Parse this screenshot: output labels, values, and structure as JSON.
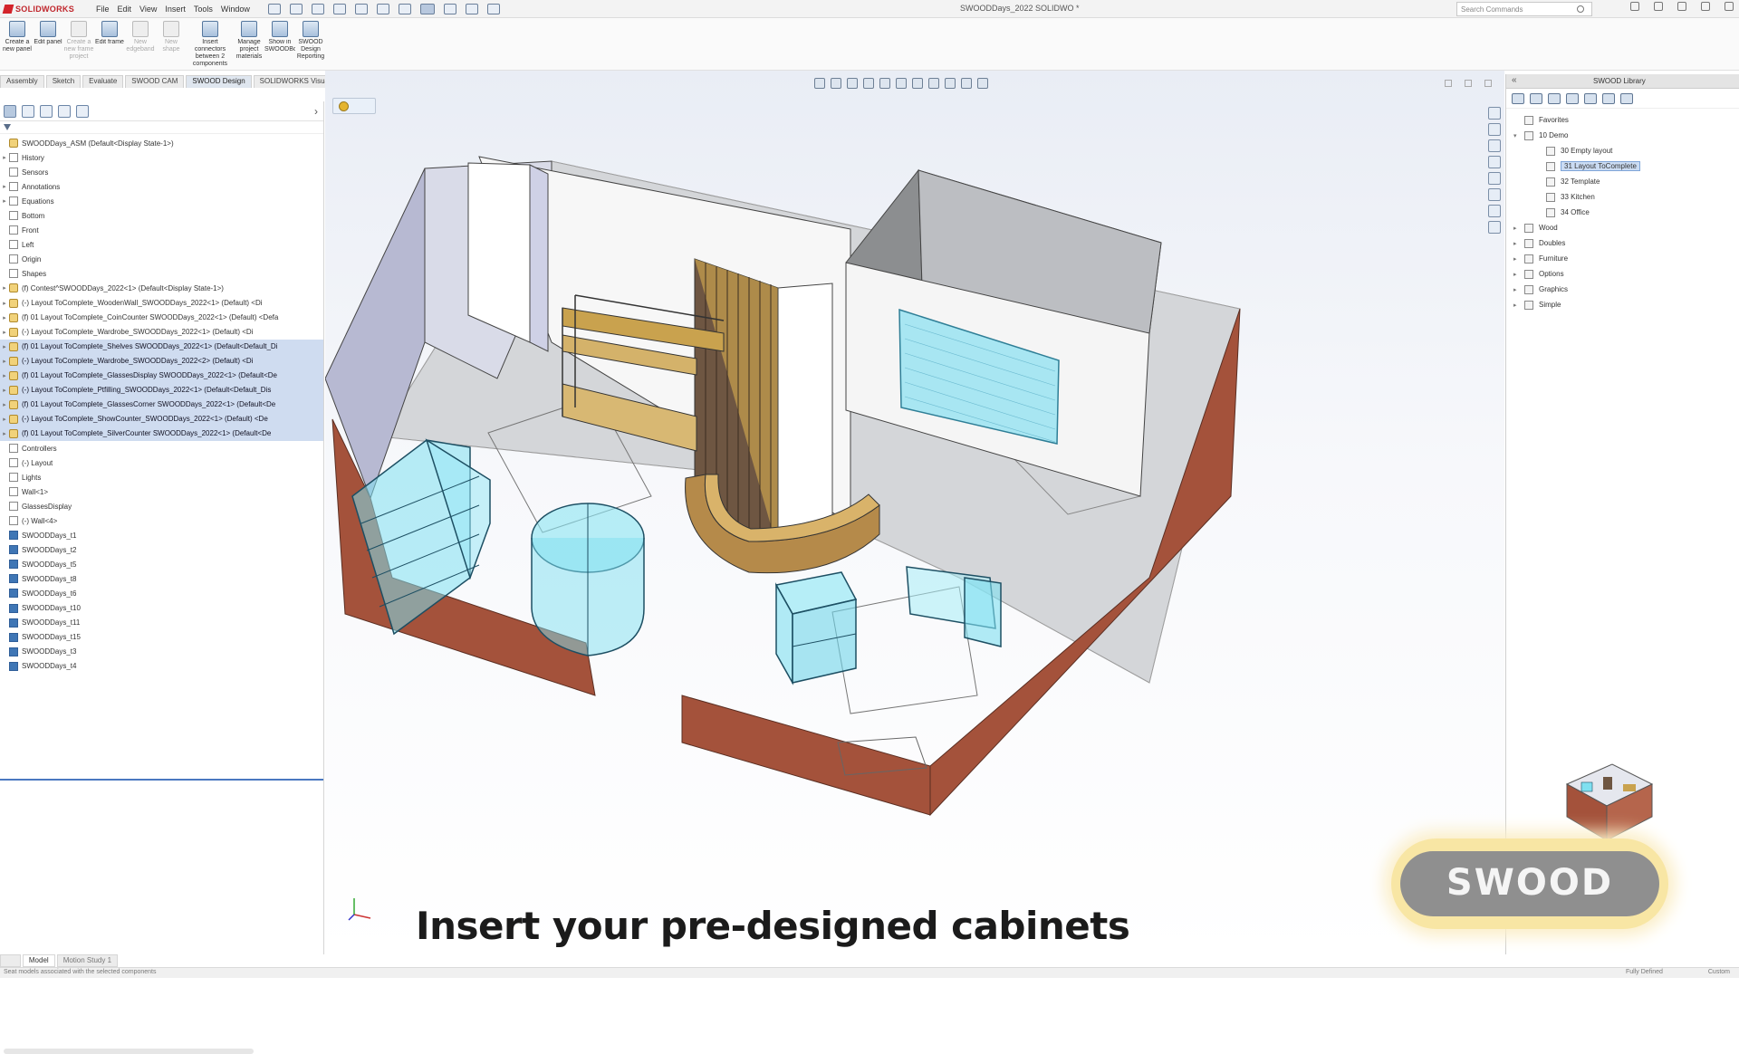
{
  "app": {
    "brand": "SOLIDWORKS",
    "doc_title": "SWOODDays_2022 SOLIDWO *"
  },
  "menu": [
    "File",
    "Edit",
    "View",
    "Insert",
    "Tools",
    "Window"
  ],
  "search": {
    "placeholder": "Search Commands"
  },
  "command_manager": [
    {
      "label": "Create a new panel",
      "enabled": true
    },
    {
      "label": "Edit panel",
      "enabled": true
    },
    {
      "label": "Create a new frame project",
      "enabled": false
    },
    {
      "label": "Edit frame",
      "enabled": true
    },
    {
      "label": "New edgeband",
      "enabled": false
    },
    {
      "label": "New shape",
      "enabled": false
    },
    {
      "label": "Insert connectors between 2 components",
      "enabled": true
    },
    {
      "label": "Manage project materials",
      "enabled": true
    },
    {
      "label": "Show in SWOODBox",
      "enabled": true
    },
    {
      "label": "SWOOD Design Reporting",
      "enabled": true
    }
  ],
  "tabs": [
    "Assembly",
    "Sketch",
    "Evaluate",
    "SWOOD CAM",
    "SWOOD Design",
    "SOLIDWORKS Visualize"
  ],
  "active_tab": "SWOOD Design",
  "feature_tree": [
    {
      "label": "SWOODDays_ASM (Default<Display State-1>)",
      "icon": "asm",
      "toggle": "",
      "selected": false
    },
    {
      "label": "History",
      "icon": "plane",
      "toggle": "▸",
      "selected": false
    },
    {
      "label": "Sensors",
      "icon": "plane",
      "toggle": "",
      "selected": false
    },
    {
      "label": "Annotations",
      "icon": "plane",
      "toggle": "▸",
      "selected": false
    },
    {
      "label": "Equations",
      "icon": "plane",
      "toggle": "▸",
      "selected": false
    },
    {
      "label": "Bottom",
      "icon": "plane",
      "toggle": "",
      "selected": false
    },
    {
      "label": "Front",
      "icon": "plane",
      "toggle": "",
      "selected": false
    },
    {
      "label": "Left",
      "icon": "plane",
      "toggle": "",
      "selected": false
    },
    {
      "label": "Origin",
      "icon": "plane",
      "toggle": "",
      "selected": false
    },
    {
      "label": "Shapes",
      "icon": "plane",
      "toggle": "",
      "selected": false
    },
    {
      "label": "(f) Contest^SWOODDays_2022<1> (Default<Display State-1>)",
      "icon": "asm",
      "toggle": "▸",
      "selected": false
    },
    {
      "label": "(-) Layout ToComplete_WoodenWall_SWOODDays_2022<1> (Default) <Di",
      "icon": "asm",
      "toggle": "▸",
      "selected": false
    },
    {
      "label": "(f) 01 Layout ToComplete_CoinCounter SWOODDays_2022<1> (Default) <Defa",
      "icon": "asm",
      "toggle": "▸",
      "selected": false
    },
    {
      "label": "(-) Layout ToComplete_Wardrobe_SWOODDays_2022<1> (Default) <Di",
      "icon": "asm",
      "toggle": "▸",
      "selected": false
    },
    {
      "label": "(f) 01 Layout ToComplete_Shelves SWOODDays_2022<1> (Default<Default_Di",
      "icon": "asm",
      "toggle": "▸",
      "selected": true
    },
    {
      "label": "(-) Layout ToComplete_Wardrobe_SWOODDays_2022<2> (Default) <Di",
      "icon": "asm",
      "toggle": "▸",
      "selected": true
    },
    {
      "label": "(f) 01 Layout ToComplete_GlassesDisplay SWOODDays_2022<1> (Default<De",
      "icon": "asm",
      "toggle": "▸",
      "selected": true
    },
    {
      "label": "(-) Layout ToComplete_Ptfilling_SWOODDays_2022<1> (Default<Default_Dis",
      "icon": "asm",
      "toggle": "▸",
      "selected": true
    },
    {
      "label": "(f) 01 Layout ToComplete_GlassesCorner SWOODDays_2022<1> (Default<De",
      "icon": "asm",
      "toggle": "▸",
      "selected": true
    },
    {
      "label": "(-) Layout ToComplete_ShowCounter_SWOODDays_2022<1> (Default) <De",
      "icon": "asm",
      "toggle": "▸",
      "selected": true
    },
    {
      "label": "(f) 01 Layout ToComplete_SilverCounter SWOODDays_2022<1> (Default<De",
      "icon": "asm",
      "toggle": "▸",
      "selected": true
    },
    {
      "label": "Controllers",
      "icon": "plane",
      "toggle": "",
      "selected": false
    },
    {
      "label": "(-) Layout",
      "icon": "plane",
      "toggle": "",
      "selected": false
    },
    {
      "label": "Lights",
      "icon": "plane",
      "toggle": "",
      "selected": false
    },
    {
      "label": "Wall<1>",
      "icon": "plane",
      "toggle": "",
      "selected": false
    },
    {
      "label": "GlassesDisplay",
      "icon": "plane",
      "toggle": "",
      "selected": false
    },
    {
      "label": "(-) Wall<4>",
      "icon": "plane",
      "toggle": "",
      "selected": false
    },
    {
      "label": "SWOODDays_t1",
      "icon": "part",
      "toggle": "",
      "selected": false
    },
    {
      "label": "SWOODDays_t2",
      "icon": "part",
      "toggle": "",
      "selected": false
    },
    {
      "label": "SWOODDays_t5",
      "icon": "part",
      "toggle": "",
      "selected": false
    },
    {
      "label": "SWOODDays_t8",
      "icon": "part",
      "toggle": "",
      "selected": false
    },
    {
      "label": "SWOODDays_t6",
      "icon": "part",
      "toggle": "",
      "selected": false
    },
    {
      "label": "SWOODDays_t10",
      "icon": "part",
      "toggle": "",
      "selected": false
    },
    {
      "label": "SWOODDays_t11",
      "icon": "part",
      "toggle": "",
      "selected": false
    },
    {
      "label": "SWOODDays_t15",
      "icon": "part",
      "toggle": "",
      "selected": false
    },
    {
      "label": "SWOODDays_t3",
      "icon": "part",
      "toggle": "",
      "selected": false
    },
    {
      "label": "SWOODDays_t4",
      "icon": "part",
      "toggle": "",
      "selected": false
    }
  ],
  "task_pane": {
    "title": "SWOOD Library",
    "items": [
      {
        "label": "Favorites",
        "toggle": "",
        "indent": 0,
        "selected": false
      },
      {
        "label": "10 Demo",
        "toggle": "▾",
        "indent": 0,
        "selected": false
      },
      {
        "label": "30 Empty layout",
        "toggle": "",
        "indent": 2,
        "selected": false
      },
      {
        "label": "31 Layout ToComplete",
        "toggle": "",
        "indent": 2,
        "selected": true
      },
      {
        "label": "32 Template",
        "toggle": "",
        "indent": 2,
        "selected": false
      },
      {
        "label": "33 Kitchen",
        "toggle": "",
        "indent": 2,
        "selected": false
      },
      {
        "label": "34 Office",
        "toggle": "",
        "indent": 2,
        "selected": false
      },
      {
        "label": "Wood",
        "toggle": "▸",
        "indent": 0,
        "selected": false
      },
      {
        "label": "Doubles",
        "toggle": "▸",
        "indent": 0,
        "selected": false
      },
      {
        "label": "Furniture",
        "toggle": "▸",
        "indent": 0,
        "selected": false
      },
      {
        "label": "Options",
        "toggle": "▸",
        "indent": 0,
        "selected": false
      },
      {
        "label": "Graphics",
        "toggle": "▸",
        "indent": 0,
        "selected": false
      },
      {
        "label": "Simple",
        "toggle": "▸",
        "indent": 0,
        "selected": false
      }
    ]
  },
  "caption": "Insert your pre-designed cabinets",
  "watermark": "SWOOD",
  "bottom_tabs": [
    "Model",
    "Motion Study 1"
  ],
  "status": {
    "left": "Seat models associated with the selected components",
    "right_1": "Fully Defined",
    "right_2": "Custom"
  },
  "colors": {
    "accent": "#4a78c0",
    "brand_red": "#c0262c",
    "glass": "#7fe0f0",
    "brick": "#a5503a",
    "wood": "#c9a24e"
  }
}
